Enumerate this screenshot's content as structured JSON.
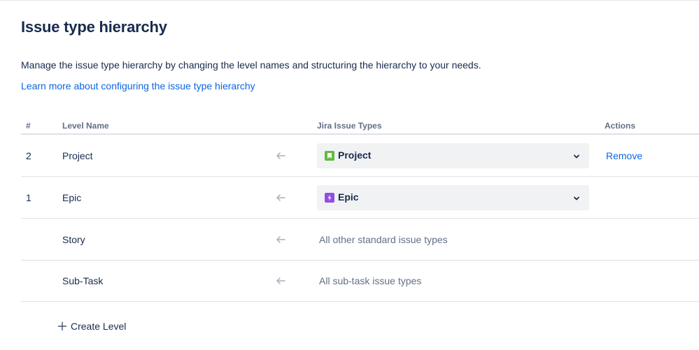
{
  "page": {
    "title": "Issue type hierarchy",
    "description": "Manage the issue type hierarchy by changing the level names and structuring the hierarchy to your needs.",
    "learn_more": "Learn more about configuring the issue type hierarchy"
  },
  "table": {
    "headers": {
      "num": "#",
      "level": "Level Name",
      "types": "Jira Issue Types",
      "actions": "Actions"
    },
    "rows": [
      {
        "num": "2",
        "level": "Project",
        "type_select": "Project",
        "type_icon": "project-icon",
        "action": "Remove"
      },
      {
        "num": "1",
        "level": "Epic",
        "type_select": "Epic",
        "type_icon": "epic-icon"
      },
      {
        "num": "",
        "level": "Story",
        "types_text": "All other standard issue types"
      },
      {
        "num": "",
        "level": "Sub-Task",
        "types_text": "All sub-task issue types"
      }
    ]
  },
  "create_level": "Create Level",
  "colors": {
    "link": "#0c66e4",
    "project_icon": "#63ba3c",
    "epic_icon": "#904ee2",
    "text_primary": "#172b4d",
    "text_subtle": "#626f86"
  }
}
